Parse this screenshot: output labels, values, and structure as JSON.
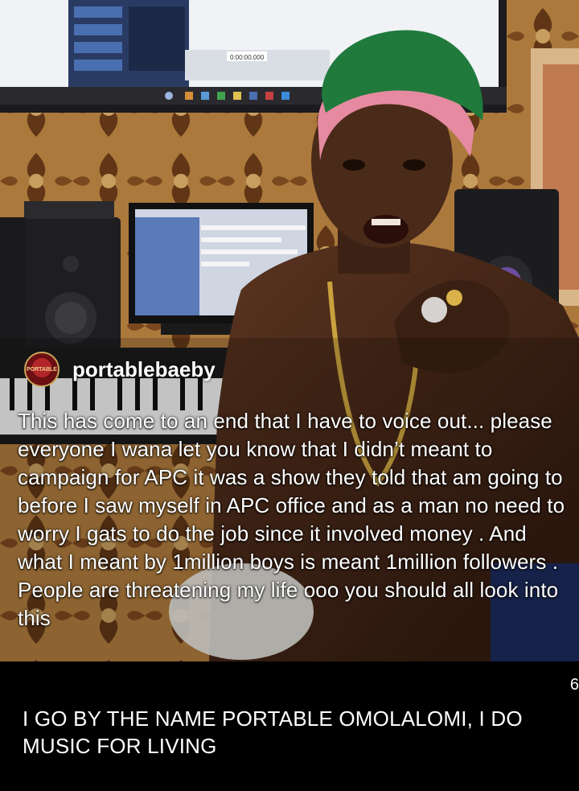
{
  "post": {
    "handle": "portablebaeby",
    "avatar_text": "PORTABLE",
    "overlay_text": "This has come to an end that I have to voice out... please everyone I wana let you know that I didn’t meant to campaign for APC it was a show they told that am going to before I saw myself in APC office and as a man no need to worry I gats to do the job since it involved money . And what I meant by 1million boys is meant 1million followers . People are threatening my life ooo you should all look into this"
  },
  "caption": {
    "text": "I GO BY THE NAME PORTABLE OMOLALOMI, I DO MUSIC FOR LIVING"
  },
  "monitor": {
    "timecode": "0:00:00.000"
  },
  "edge_mark": "6",
  "colors": {
    "background": "#000000",
    "cap_green": "#1f7a3c",
    "hair_pink": "#e58aa0",
    "text": "#ffffff"
  }
}
